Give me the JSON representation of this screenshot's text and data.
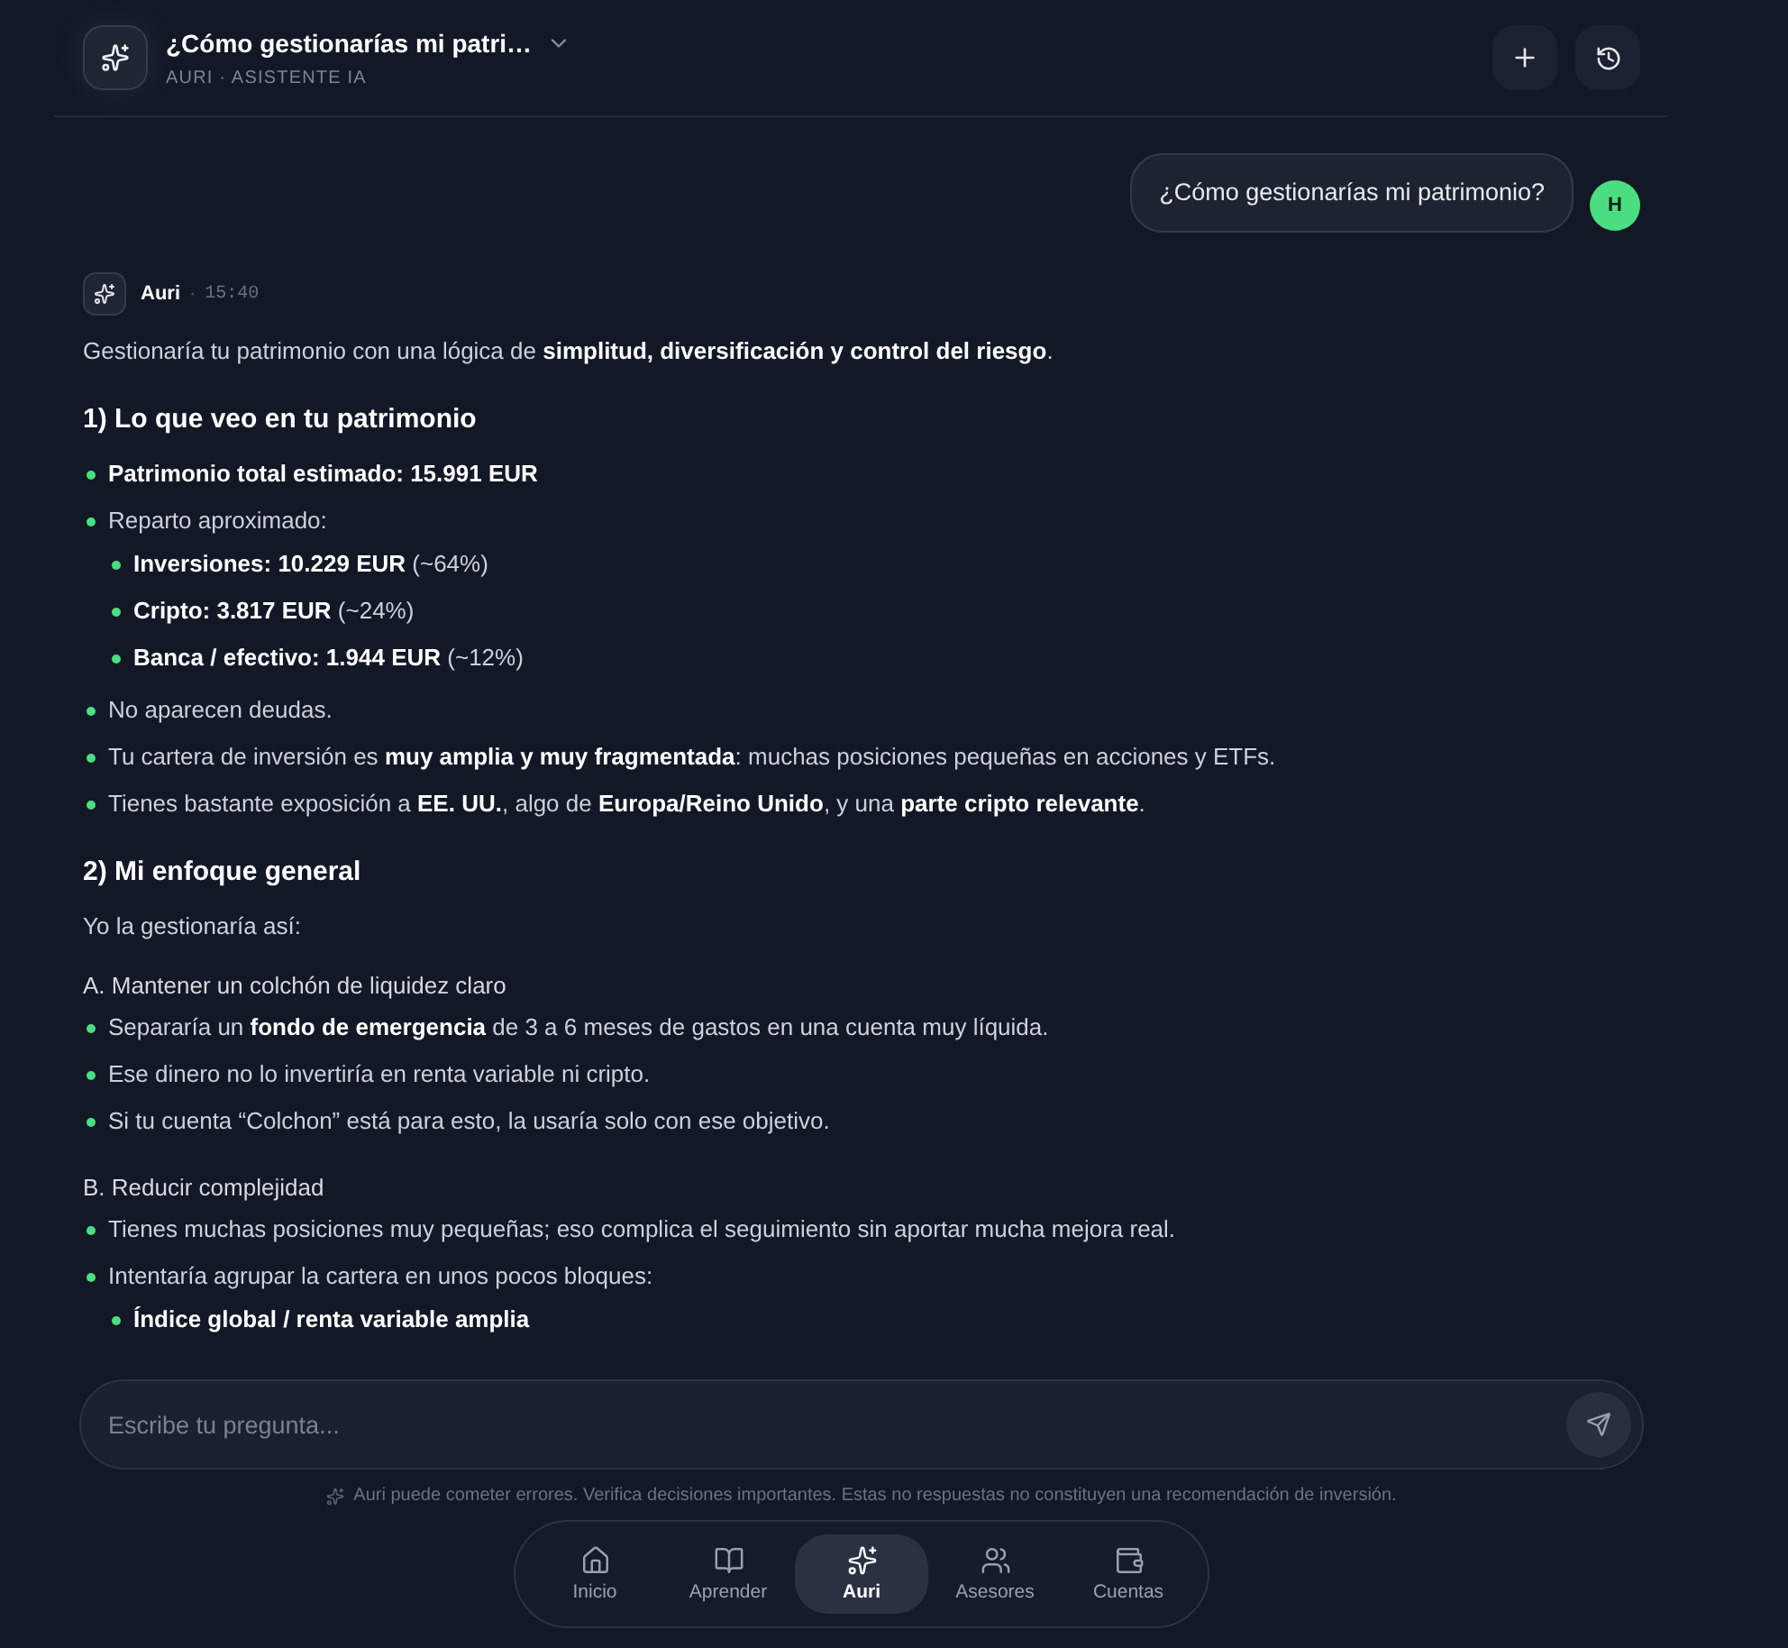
{
  "header": {
    "title": "¿Cómo gestionarías mi patri…",
    "subtitle": "AURI · ASISTENTE IA"
  },
  "messages": [
    {
      "kind": "user",
      "text": "¿Cómo gestionarías mi patrimonio?",
      "avatar": "H"
    },
    {
      "kind": "assistant",
      "author": "Auri",
      "separator": "·",
      "time": "15:40",
      "blocks": [
        {
          "kind": "paragraph",
          "text": "Gestionaría tu patrimonio con una lógica de **simplitud, diversificación y control del riesgo**."
        },
        {
          "kind": "heading",
          "text": "1) Lo que veo en tu patrimonio"
        },
        {
          "kind": "list",
          "items": [
            {
              "text": "**Patrimonio total estimado: 15.991 EUR**"
            },
            {
              "text": "Reparto aproximado:",
              "children": [
                {
                  "text": "**Inversiones: 10.229 EUR** (~64%)"
                },
                {
                  "text": "**Cripto: 3.817 EUR** (~24%)"
                },
                {
                  "text": "**Banca / efectivo: 1.944 EUR** (~12%)"
                }
              ]
            },
            {
              "text": "No aparecen deudas."
            },
            {
              "text": "Tu cartera de inversión es **muy amplia y muy fragmentada**: muchas posiciones pequeñas en acciones y ETFs."
            },
            {
              "text": "Tienes bastante exposición a **EE. UU.**, algo de **Europa/Reino Unido**, y una **parte cripto relevante**."
            }
          ]
        },
        {
          "kind": "heading",
          "text": "2) Mi enfoque general"
        },
        {
          "kind": "paragraph",
          "text": "Yo la gestionaría así:"
        },
        {
          "kind": "label",
          "text": "A. Mantener un colchón de liquidez claro"
        },
        {
          "kind": "list",
          "items": [
            {
              "text": "Separaría un **fondo de emergencia** de 3 a 6 meses de gastos en una cuenta muy líquida."
            },
            {
              "text": "Ese dinero no lo invertiría en renta variable ni cripto."
            },
            {
              "text": "Si tu cuenta “Colchon” está para esto, la usaría solo con ese objetivo."
            }
          ]
        },
        {
          "kind": "label",
          "text": "B. Reducir complejidad"
        },
        {
          "kind": "list",
          "items": [
            {
              "text": "Tienes muchas posiciones muy pequeñas; eso complica el seguimiento sin aportar mucha mejora real."
            },
            {
              "text": "Intentaría agrupar la cartera en unos pocos bloques:",
              "children": [
                {
                  "text": "**Índice global / renta variable amplia**"
                }
              ]
            }
          ]
        }
      ]
    }
  ],
  "composer": {
    "placeholder": "Escribe tu pregunta..."
  },
  "disclaimer": "Auri puede cometer errores. Verifica decisiones importantes. Estas no respuestas no constituyen una recomendación de inversión.",
  "nav": [
    {
      "label": "Inicio",
      "selected": false
    },
    {
      "label": "Aprender",
      "selected": false
    },
    {
      "label": "Auri",
      "selected": true
    },
    {
      "label": "Asesores",
      "selected": false
    },
    {
      "label": "Cuentas",
      "selected": false
    }
  ]
}
